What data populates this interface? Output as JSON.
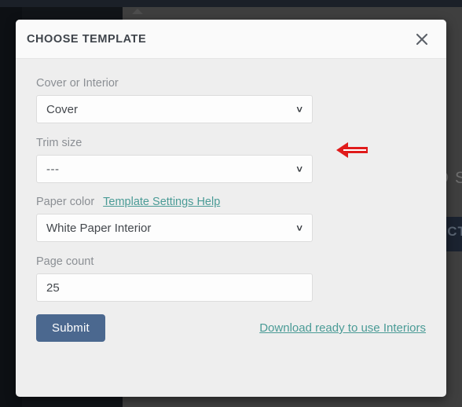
{
  "background": {
    "text_fragment_1": "D S",
    "text_fragment_2": "UCT"
  },
  "modal": {
    "title": "CHOOSE TEMPLATE",
    "close_icon": "close-icon",
    "fields": [
      {
        "label": "Cover or Interior",
        "type": "select",
        "value": "Cover",
        "chevron": "˅"
      },
      {
        "label": "Trim size",
        "type": "select",
        "value": "---",
        "chevron": "˅",
        "pointer": "red-left-arrow"
      },
      {
        "label": "Paper color",
        "helper_link": "Template Settings Help",
        "type": "select",
        "value": "White Paper Interior",
        "chevron": "˅"
      },
      {
        "label": "Page count",
        "type": "text",
        "value": "25",
        "placeholder": ""
      }
    ],
    "footer": {
      "submit_label": "Submit",
      "download_link": "Download ready to use Interiors"
    }
  },
  "colors": {
    "accent_link": "#4a9b96",
    "submit_bg": "#4b688f",
    "pointer_red": "#e01b1b",
    "modal_bg": "#eeeeee",
    "header_bg": "#fafafa"
  }
}
